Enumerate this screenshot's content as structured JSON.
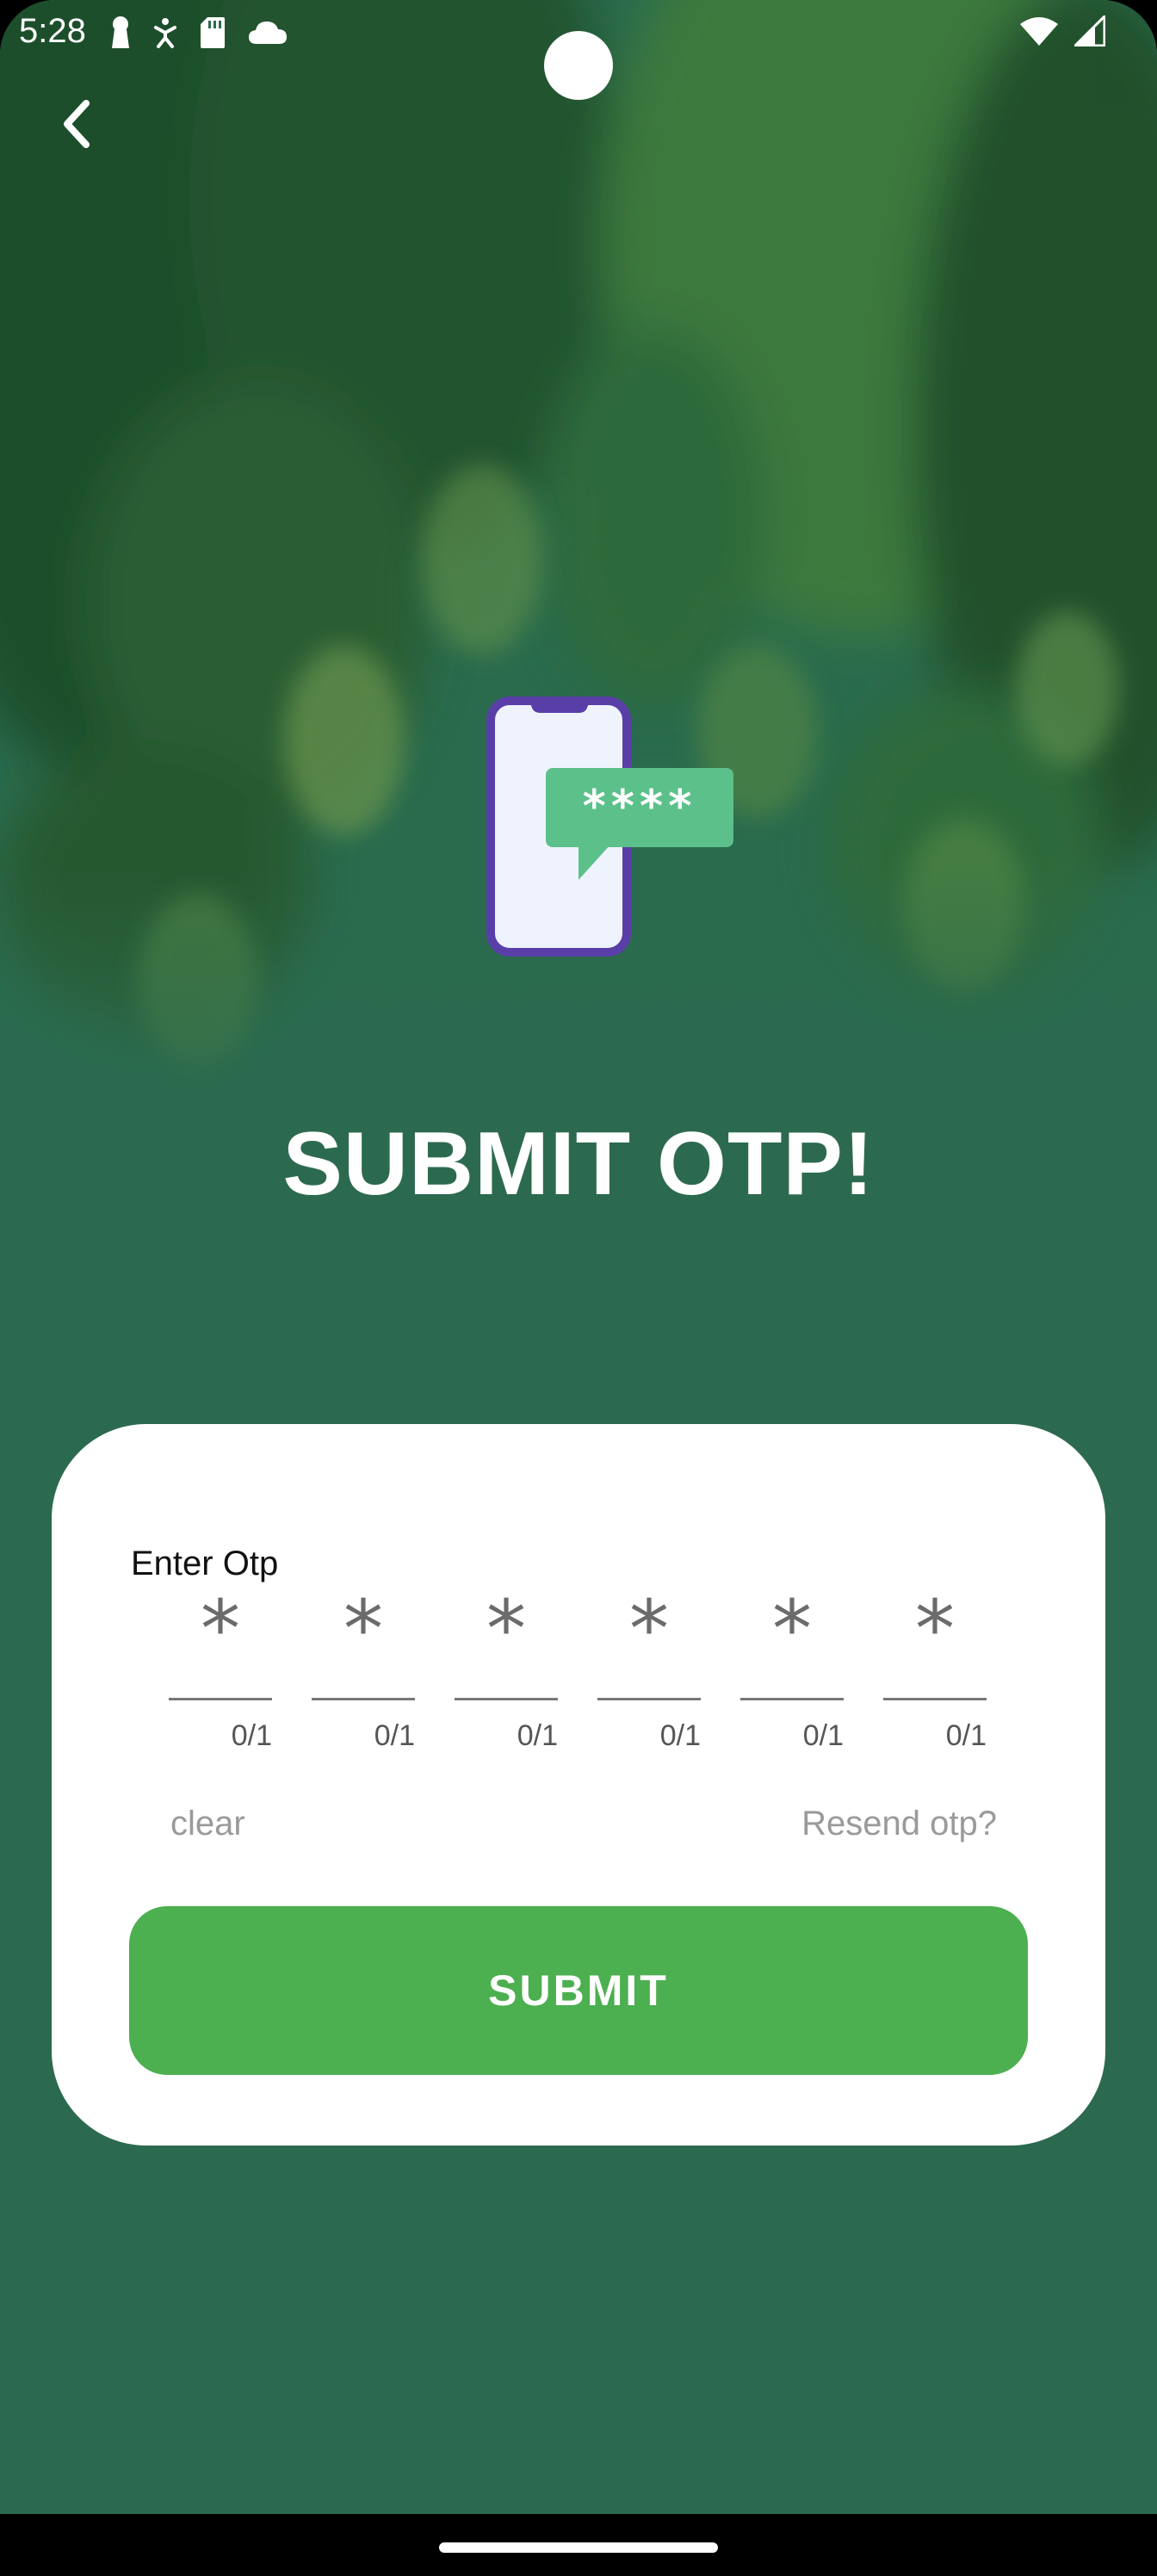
{
  "status_bar": {
    "time": "5:28",
    "left_icons": [
      "keyhole-icon",
      "accessibility-icon",
      "sd-card-icon",
      "cloud-icon"
    ],
    "right_icons": [
      "wifi-icon",
      "signal-icon"
    ]
  },
  "nav": {
    "back_icon": "chevron-left-icon"
  },
  "title": "SUBMIT OTP!",
  "illustration": {
    "bubble_text": "****"
  },
  "otp": {
    "label": "Enter Otp",
    "digits": [
      {
        "value": "*",
        "counter": "0/1"
      },
      {
        "value": "*",
        "counter": "0/1"
      },
      {
        "value": "*",
        "counter": "0/1"
      },
      {
        "value": "*",
        "counter": "0/1"
      },
      {
        "value": "*",
        "counter": "0/1"
      },
      {
        "value": "*",
        "counter": "0/1"
      }
    ],
    "clear_label": "clear",
    "resend_label": "Resend otp?",
    "submit_label": "SUBMIT"
  },
  "colors": {
    "background": "#2c6a4f",
    "accent": "#4caf50",
    "phone_frame": "#5a3ea8",
    "bubble": "#5cc08a"
  }
}
